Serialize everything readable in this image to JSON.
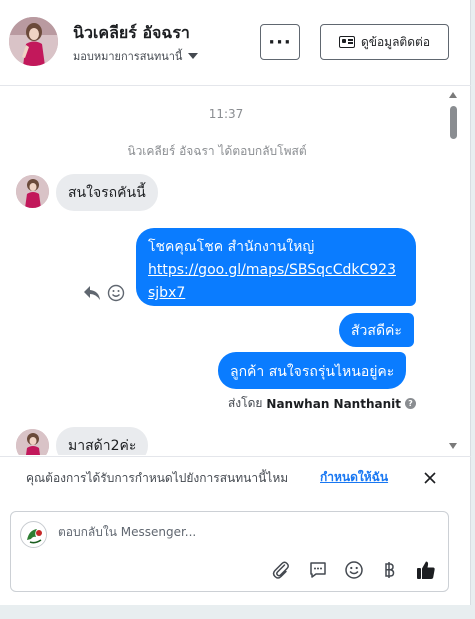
{
  "header": {
    "contact_name": "นิวเคลียร์ อัจฉรา",
    "assign_label": "มอบหมายการสนทนานี้",
    "more_label": "···",
    "contact_info_label": "ดูข้อมูลติดต่อ"
  },
  "thread": {
    "timestamp": "11:37",
    "event": "นิวเคลียร์ อัจฉรา ได้ตอบกลับโพสต์",
    "messages": [
      {
        "direction": "in",
        "text": "สนใจรถคันนี้"
      },
      {
        "direction": "out",
        "line1": "โชคคุณโชค สำนักงานใหญ่",
        "link_line1": "https://goo.gl/maps/SBSqcCdkC923",
        "link_line2": "sjbx7"
      },
      {
        "direction": "out",
        "text": "สัวสดีค่ะ"
      },
      {
        "direction": "out",
        "text": "ลูกค้า สนใจรถรุ่นไหนอยู่คะ"
      },
      {
        "direction": "in",
        "text": "มาสด้า2ค่ะ"
      }
    ],
    "sent_by_prefix": "ส่งโดย",
    "sent_by_name": "Nanwhan Nanthanit"
  },
  "banner": {
    "text": "คุณต้องการได้รับการกำหนดไปยังการสนทนานี้ไหม",
    "link": "กำหนดให้ฉัน"
  },
  "composer": {
    "placeholder": "ตอบกลับใน Messenger..."
  },
  "colors": {
    "accent": "#0a7cff",
    "link": "#1877f2",
    "incoming_bubble": "#e9ebee"
  },
  "icons": [
    "more-icon",
    "contact-card-icon",
    "caret-down-icon",
    "reply-icon",
    "smiley-icon",
    "help-icon",
    "close-icon",
    "attach-icon",
    "saved-replies-icon",
    "emoji-icon",
    "baht-icon",
    "thumbs-up-icon"
  ]
}
